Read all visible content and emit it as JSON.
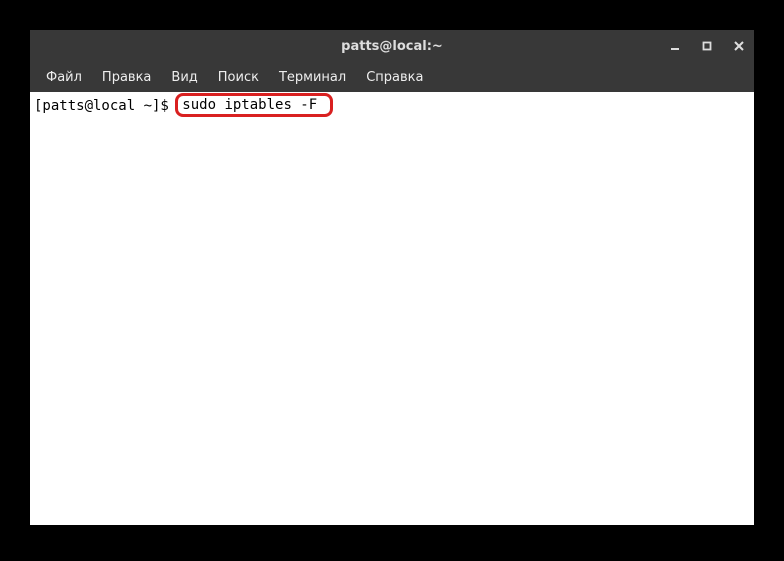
{
  "window": {
    "title": "patts@local:~"
  },
  "menubar": {
    "items": [
      {
        "label": "Файл"
      },
      {
        "label": "Правка"
      },
      {
        "label": "Вид"
      },
      {
        "label": "Поиск"
      },
      {
        "label": "Терминал"
      },
      {
        "label": "Справка"
      }
    ]
  },
  "terminal": {
    "prompt": "[patts@local ~]$ ",
    "command": "sudo iptables -F "
  }
}
